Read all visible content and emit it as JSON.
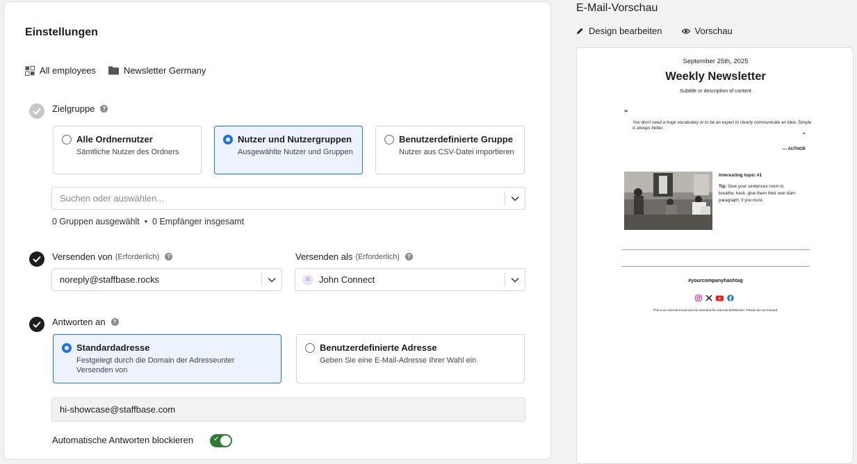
{
  "settings": {
    "title": "Einstellungen",
    "breadcrumbs": [
      {
        "icon": "grid-icon",
        "label": "All employees"
      },
      {
        "icon": "folder-icon",
        "label": "Newsletter Germany"
      }
    ]
  },
  "zielgruppe": {
    "label": "Zielgruppe",
    "options": [
      {
        "title": "Alle Ordnernutzer",
        "desc": "Sämtliche Nutzer des Ordners",
        "selected": false
      },
      {
        "title": "Nutzer und Nutzergruppen",
        "desc": "Ausgewählte Nutzer und Gruppen",
        "selected": true
      },
      {
        "title": "Benutzerdefinierte Gruppe",
        "desc": "Nutzer aus CSV-Datei importieren",
        "selected": false
      }
    ],
    "search_placeholder": "Suchen oder auswählen...",
    "summary": "0 Gruppen ausgewählt  •  0 Empfänger insgesamt"
  },
  "versenden_von": {
    "label": "Versenden von",
    "required": "(Erforderlich)",
    "value": "noreply@staffbase.rocks"
  },
  "versenden_als": {
    "label": "Versenden als",
    "required": "(Erforderlich)",
    "avatar_initials": "JC",
    "value": "John Connect"
  },
  "antworten_an": {
    "label": "Antworten an",
    "options": [
      {
        "title": "Standardadresse",
        "desc": "Festgelegt durch die Domain der Adresseunter Versenden von",
        "selected": true
      },
      {
        "title": "Benutzerdefinierte Adresse",
        "desc": "Geben Sie eine E-Mail-Adresse Ihrer Wahl ein",
        "selected": false
      }
    ],
    "address": "hi-showcase@staffbase.com"
  },
  "auto_reply": {
    "label": "Automatische Antworten blockieren",
    "enabled": true
  },
  "preview": {
    "title": "E-Mail-Vorschau",
    "actions": {
      "edit": "Design bearbeiten",
      "view": "Vorschau"
    },
    "newsletter": {
      "date": "September 25th, 2025",
      "heading": "Weekly Newsletter",
      "subtitle": "Subtitle or description of content",
      "quote": "You don't need a huge vocabulary or to be an expert to clearly communicate an idea. Simple is always better.",
      "author": "— AUTHOR",
      "topic_title": "Interesting topic #1",
      "topic_tip_label": "Tip:",
      "topic_tip": "Give your sentences room to breathe; heck, give them their own darn paragraph, if you must.",
      "hashtag": "#yourcompanyhashtag",
      "disclaimer": "This is an internal email and not intended for external distribution. Please do not forward."
    }
  },
  "colors": {
    "accent": "#1a73e8",
    "selected_bg": "#edf3fd",
    "toggle_on": "#2e7d32"
  }
}
